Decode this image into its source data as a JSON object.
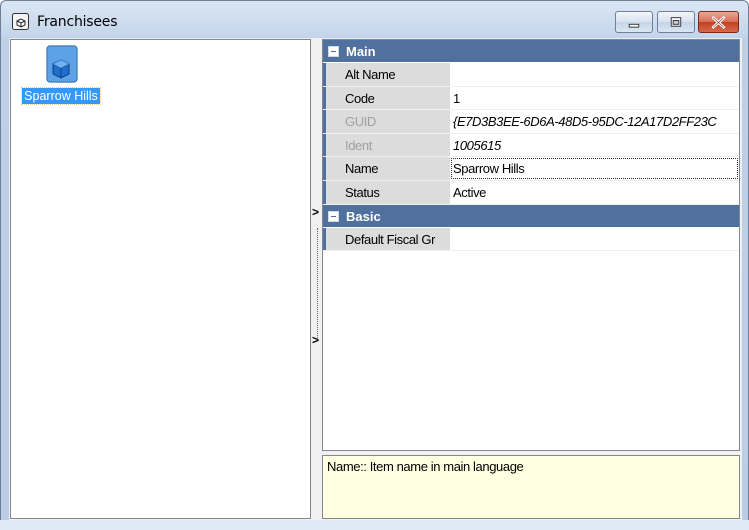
{
  "window": {
    "title": "Franchisees",
    "icon": "box-window-icon",
    "controls": {
      "minimize": "minimize-icon",
      "maximize": "maximize-icon",
      "close": "close-icon"
    }
  },
  "tree": {
    "items": [
      {
        "label": "Sparrow Hills",
        "icon": "cube-icon",
        "selected": true
      }
    ]
  },
  "splitter": {
    "collapse_glyph": ">",
    "expand_glyph": ">"
  },
  "property_grid": {
    "categories": [
      {
        "label": "Main",
        "properties": [
          {
            "name": "Alt Name",
            "value": ""
          },
          {
            "name": "Code",
            "value": "1"
          },
          {
            "name": "GUID",
            "value": "{E7D3B3EE-6D6A-48D5-95DC-12A17D2FF23C",
            "disabled": true
          },
          {
            "name": "Ident",
            "value": "1005615",
            "disabled": true
          },
          {
            "name": "Name",
            "value": "Sparrow Hills",
            "selected": true
          },
          {
            "name": "Status",
            "value": "Active"
          }
        ]
      },
      {
        "label": "Basic",
        "properties": [
          {
            "name": "Default Fiscal Gr",
            "value": ""
          }
        ]
      }
    ]
  },
  "description": {
    "text": "Name:: Item name in main language"
  },
  "colors": {
    "category_bg": "#50709d",
    "selection": "#3399ff",
    "description_bg": "#ffffe1"
  }
}
